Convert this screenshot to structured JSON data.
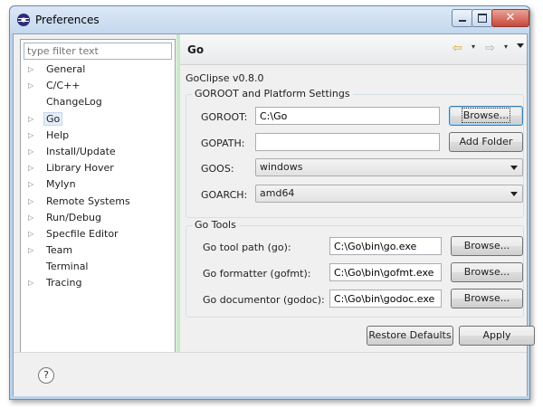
{
  "window": {
    "title": "Preferences",
    "close_glyph": "✕"
  },
  "filter": {
    "placeholder": "type filter text"
  },
  "tree": [
    {
      "label": "General",
      "expandable": true
    },
    {
      "label": "C/C++",
      "expandable": true
    },
    {
      "label": "ChangeLog",
      "expandable": false
    },
    {
      "label": "Go",
      "expandable": true,
      "selected": true
    },
    {
      "label": "Help",
      "expandable": true
    },
    {
      "label": "Install/Update",
      "expandable": true
    },
    {
      "label": "Library Hover",
      "expandable": true
    },
    {
      "label": "Mylyn",
      "expandable": true
    },
    {
      "label": "Remote Systems",
      "expandable": true
    },
    {
      "label": "Run/Debug",
      "expandable": true
    },
    {
      "label": "Specfile Editor",
      "expandable": true
    },
    {
      "label": "Team",
      "expandable": true
    },
    {
      "label": "Terminal",
      "expandable": false
    },
    {
      "label": "Tracing",
      "expandable": true
    }
  ],
  "page": {
    "title": "Go",
    "nav": {
      "back_icon": "⇦",
      "forward_icon": "⇨",
      "dropdown": "▾"
    },
    "version": "GoClipse v0.8.0",
    "goroot_group": {
      "title": "GOROOT and Platform Settings",
      "goroot_label": "GOROOT:",
      "goroot_value": "C:\\Go",
      "browse_label": "Browse...",
      "gopath_label": "GOPATH:",
      "gopath_value": "",
      "add_folder_label": "Add Folder",
      "goos_label": "GOOS:",
      "goos_value": "windows",
      "goarch_label": "GOARCH:",
      "goarch_value": "amd64"
    },
    "tools_group": {
      "title": "Go Tools",
      "go_label": "Go tool path (go):",
      "go_value": "C:\\Go\\bin\\go.exe",
      "gofmt_label": "Go formatter (gofmt):",
      "gofmt_value": "C:\\Go\\bin\\gofmt.exe",
      "godoc_label": "Go documentor (godoc):",
      "godoc_value": "C:\\Go\\bin\\godoc.exe",
      "browse_label": "Browse..."
    },
    "restore_defaults_label": "Restore Defaults",
    "apply_label": "Apply"
  },
  "help": {
    "glyph": "?"
  }
}
